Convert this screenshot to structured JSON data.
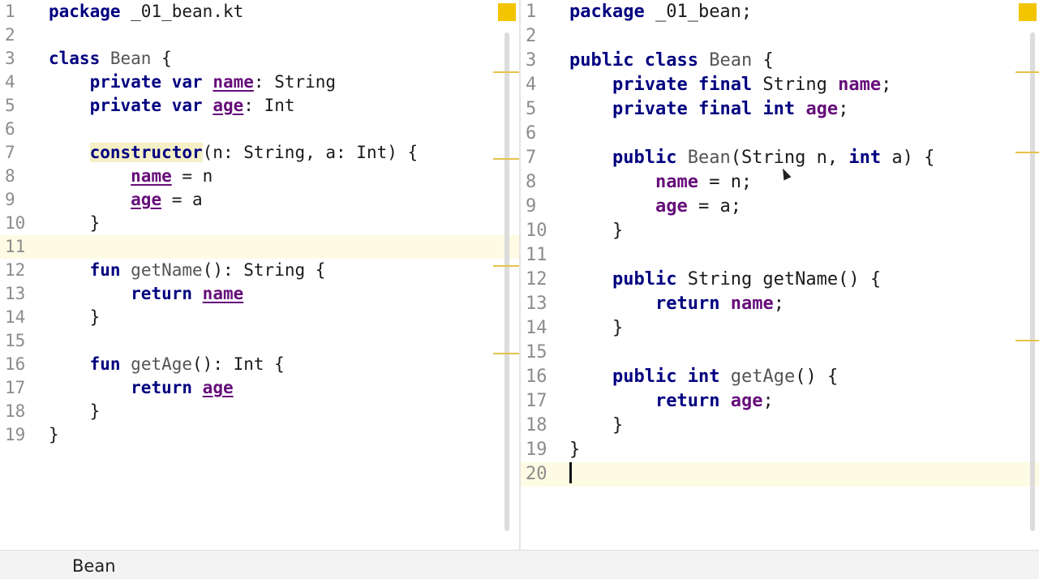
{
  "left_editor": {
    "lines": [
      {
        "n": "1",
        "tokens": [
          {
            "t": "package",
            "c": "kw"
          },
          {
            "t": " _01_bean.kt",
            "c": "pl"
          }
        ]
      },
      {
        "n": "2",
        "tokens": []
      },
      {
        "n": "3",
        "tokens": [
          {
            "t": "class",
            "c": "kw"
          },
          {
            "t": " ",
            "c": "pl"
          },
          {
            "t": "Bean",
            "c": "cls"
          },
          {
            "t": " {",
            "c": "pl"
          }
        ]
      },
      {
        "n": "4",
        "tokens": [
          {
            "t": "    ",
            "c": "pl"
          },
          {
            "t": "private",
            "c": "kw"
          },
          {
            "t": " ",
            "c": "pl"
          },
          {
            "t": "var",
            "c": "kw"
          },
          {
            "t": " ",
            "c": "pl"
          },
          {
            "t": "name",
            "c": "fld ul"
          },
          {
            "t": ": String",
            "c": "pl"
          }
        ]
      },
      {
        "n": "5",
        "tokens": [
          {
            "t": "    ",
            "c": "pl"
          },
          {
            "t": "private",
            "c": "kw"
          },
          {
            "t": " ",
            "c": "pl"
          },
          {
            "t": "var",
            "c": "kw"
          },
          {
            "t": " ",
            "c": "pl"
          },
          {
            "t": "age",
            "c": "fld ul"
          },
          {
            "t": ": Int",
            "c": "pl"
          }
        ]
      },
      {
        "n": "6",
        "tokens": []
      },
      {
        "n": "7",
        "tokens": [
          {
            "t": "    ",
            "c": "pl"
          },
          {
            "t": "constructor",
            "c": "kw hl"
          },
          {
            "t": "(n: String, a: Int) {",
            "c": "pl"
          }
        ]
      },
      {
        "n": "8",
        "tokens": [
          {
            "t": "        ",
            "c": "pl"
          },
          {
            "t": "name",
            "c": "fld ul"
          },
          {
            "t": " = n",
            "c": "pl"
          }
        ]
      },
      {
        "n": "9",
        "tokens": [
          {
            "t": "        ",
            "c": "pl"
          },
          {
            "t": "age",
            "c": "fld ul"
          },
          {
            "t": " = a",
            "c": "pl"
          }
        ]
      },
      {
        "n": "10",
        "tokens": [
          {
            "t": "    }",
            "c": "pl"
          }
        ]
      },
      {
        "n": "11",
        "tokens": [],
        "current": true
      },
      {
        "n": "12",
        "tokens": [
          {
            "t": "    ",
            "c": "pl"
          },
          {
            "t": "fun",
            "c": "kw"
          },
          {
            "t": " ",
            "c": "pl"
          },
          {
            "t": "getName",
            "c": "fn"
          },
          {
            "t": "(): String {",
            "c": "pl"
          }
        ]
      },
      {
        "n": "13",
        "tokens": [
          {
            "t": "        ",
            "c": "pl"
          },
          {
            "t": "return",
            "c": "kw"
          },
          {
            "t": " ",
            "c": "pl"
          },
          {
            "t": "name",
            "c": "fld ul"
          }
        ]
      },
      {
        "n": "14",
        "tokens": [
          {
            "t": "    }",
            "c": "pl"
          }
        ]
      },
      {
        "n": "15",
        "tokens": []
      },
      {
        "n": "16",
        "tokens": [
          {
            "t": "    ",
            "c": "pl"
          },
          {
            "t": "fun",
            "c": "kw"
          },
          {
            "t": " ",
            "c": "pl"
          },
          {
            "t": "getAge",
            "c": "fn"
          },
          {
            "t": "(): Int {",
            "c": "pl"
          }
        ]
      },
      {
        "n": "17",
        "tokens": [
          {
            "t": "        ",
            "c": "pl"
          },
          {
            "t": "return",
            "c": "kw"
          },
          {
            "t": " ",
            "c": "pl"
          },
          {
            "t": "age",
            "c": "fld ul"
          }
        ]
      },
      {
        "n": "18",
        "tokens": [
          {
            "t": "    }",
            "c": "pl"
          }
        ]
      },
      {
        "n": "19",
        "tokens": [
          {
            "t": "}",
            "c": "pl"
          }
        ]
      }
    ]
  },
  "right_editor": {
    "lines": [
      {
        "n": "1",
        "tokens": [
          {
            "t": "package",
            "c": "kw"
          },
          {
            "t": " _01_bean;",
            "c": "pl"
          }
        ]
      },
      {
        "n": "2",
        "tokens": []
      },
      {
        "n": "3",
        "tokens": [
          {
            "t": "public",
            "c": "kw"
          },
          {
            "t": " ",
            "c": "pl"
          },
          {
            "t": "class",
            "c": "kw"
          },
          {
            "t": " ",
            "c": "pl"
          },
          {
            "t": "Bean",
            "c": "cls"
          },
          {
            "t": " {",
            "c": "pl"
          }
        ]
      },
      {
        "n": "4",
        "tokens": [
          {
            "t": "    ",
            "c": "pl"
          },
          {
            "t": "private",
            "c": "kw"
          },
          {
            "t": " ",
            "c": "pl"
          },
          {
            "t": "final",
            "c": "kw"
          },
          {
            "t": " String ",
            "c": "pl"
          },
          {
            "t": "name",
            "c": "fld"
          },
          {
            "t": ";",
            "c": "pl"
          }
        ]
      },
      {
        "n": "5",
        "tokens": [
          {
            "t": "    ",
            "c": "pl"
          },
          {
            "t": "private",
            "c": "kw"
          },
          {
            "t": " ",
            "c": "pl"
          },
          {
            "t": "final",
            "c": "kw"
          },
          {
            "t": " ",
            "c": "pl"
          },
          {
            "t": "int",
            "c": "kw"
          },
          {
            "t": " ",
            "c": "pl"
          },
          {
            "t": "age",
            "c": "fld"
          },
          {
            "t": ";",
            "c": "pl"
          }
        ]
      },
      {
        "n": "6",
        "tokens": []
      },
      {
        "n": "7",
        "tokens": [
          {
            "t": "    ",
            "c": "pl"
          },
          {
            "t": "public",
            "c": "kw"
          },
          {
            "t": " ",
            "c": "pl"
          },
          {
            "t": "Bean",
            "c": "fn"
          },
          {
            "t": "(String n, ",
            "c": "pl"
          },
          {
            "t": "int",
            "c": "kw"
          },
          {
            "t": " a) {",
            "c": "pl"
          }
        ]
      },
      {
        "n": "8",
        "tokens": [
          {
            "t": "        ",
            "c": "pl"
          },
          {
            "t": "name",
            "c": "fld"
          },
          {
            "t": " = n;",
            "c": "pl"
          }
        ]
      },
      {
        "n": "9",
        "tokens": [
          {
            "t": "        ",
            "c": "pl"
          },
          {
            "t": "age",
            "c": "fld"
          },
          {
            "t": " = a;",
            "c": "pl"
          }
        ]
      },
      {
        "n": "10",
        "tokens": [
          {
            "t": "    }",
            "c": "pl"
          }
        ]
      },
      {
        "n": "11",
        "tokens": []
      },
      {
        "n": "12",
        "tokens": [
          {
            "t": "    ",
            "c": "pl"
          },
          {
            "t": "public",
            "c": "kw"
          },
          {
            "t": " String getName() {",
            "c": "pl"
          }
        ]
      },
      {
        "n": "13",
        "tokens": [
          {
            "t": "        ",
            "c": "pl"
          },
          {
            "t": "return",
            "c": "kw"
          },
          {
            "t": " ",
            "c": "pl"
          },
          {
            "t": "name",
            "c": "fld"
          },
          {
            "t": ";",
            "c": "pl"
          }
        ]
      },
      {
        "n": "14",
        "tokens": [
          {
            "t": "    }",
            "c": "pl"
          }
        ]
      },
      {
        "n": "15",
        "tokens": []
      },
      {
        "n": "16",
        "tokens": [
          {
            "t": "    ",
            "c": "pl"
          },
          {
            "t": "public",
            "c": "kw"
          },
          {
            "t": " ",
            "c": "pl"
          },
          {
            "t": "int",
            "c": "kw"
          },
          {
            "t": " ",
            "c": "pl"
          },
          {
            "t": "getAge",
            "c": "fn"
          },
          {
            "t": "() {",
            "c": "pl"
          }
        ]
      },
      {
        "n": "17",
        "tokens": [
          {
            "t": "        ",
            "c": "pl"
          },
          {
            "t": "return",
            "c": "kw"
          },
          {
            "t": " ",
            "c": "pl"
          },
          {
            "t": "age",
            "c": "fld"
          },
          {
            "t": ";",
            "c": "pl"
          }
        ]
      },
      {
        "n": "18",
        "tokens": [
          {
            "t": "    }",
            "c": "pl"
          }
        ]
      },
      {
        "n": "19",
        "tokens": [
          {
            "t": "}",
            "c": "pl"
          }
        ]
      },
      {
        "n": "20",
        "tokens": [],
        "current": true,
        "caret": true
      }
    ]
  },
  "status_bar": {
    "breadcrumb": "Bean"
  },
  "colors": {
    "keyword": "#000080",
    "field": "#660e7a",
    "marker": "#f2c500",
    "current_line": "#fdfbe3"
  }
}
